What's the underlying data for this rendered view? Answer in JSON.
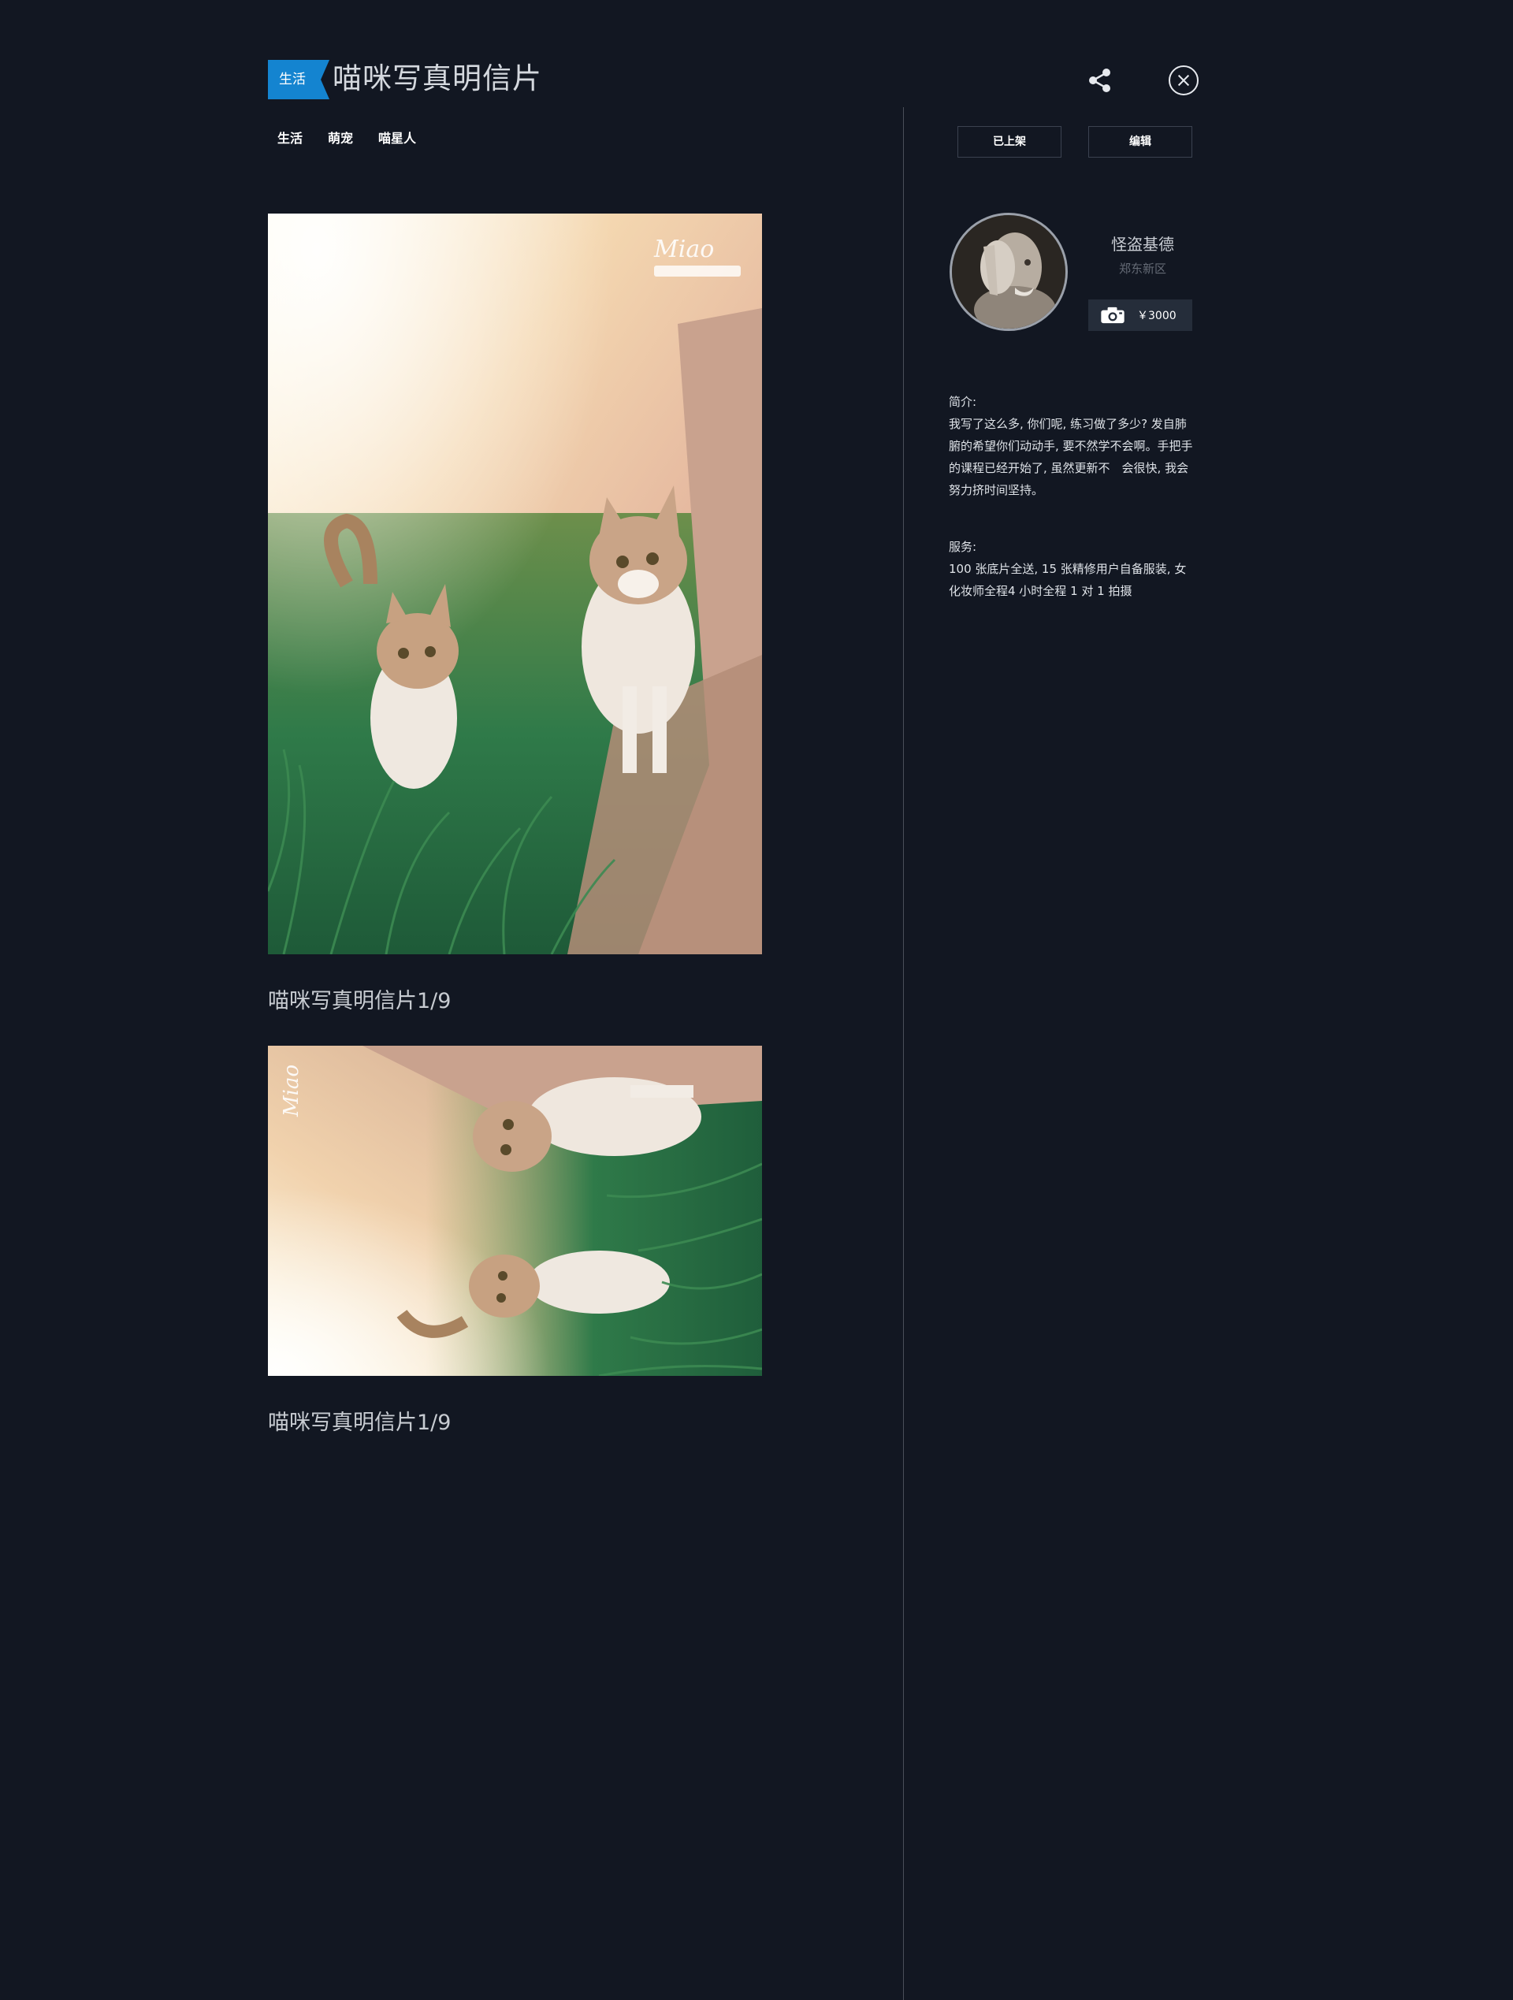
{
  "header": {
    "category": "生活",
    "title": "喵咪写真明信片"
  },
  "tags": [
    "生活",
    "萌宠",
    "喵星人"
  ],
  "actions": {
    "status": "已上架",
    "edit": "编辑"
  },
  "profile": {
    "name": "怪盗基德",
    "location": "郑东新区",
    "price": "￥3000"
  },
  "intro": {
    "heading": "简介:",
    "text": "我写了这么多, 你们呢, 练习做了多少? 发自肺腑的希望你们动动手, 要不然学不会啊。手把手的课程已经开始了, 虽然更新不　会很快, 我会努力挤时间坚持。"
  },
  "services": {
    "heading": "服务:",
    "text": "100 张底片全送, 15 张精修用户自备服装, 女化妆师全程4 小时全程 1 对 1 拍摄"
  },
  "photos": [
    {
      "caption": "喵咪写真明信片1/9",
      "watermark": "Miao"
    },
    {
      "caption": "喵咪写真明信片1/9",
      "watermark": "Miao"
    }
  ],
  "icons": {
    "share": "share-icon",
    "close": "close-icon",
    "camera": "camera-icon"
  },
  "colors": {
    "background": "#121722",
    "accent": "#1484d0",
    "price_bg": "#252d3a"
  }
}
